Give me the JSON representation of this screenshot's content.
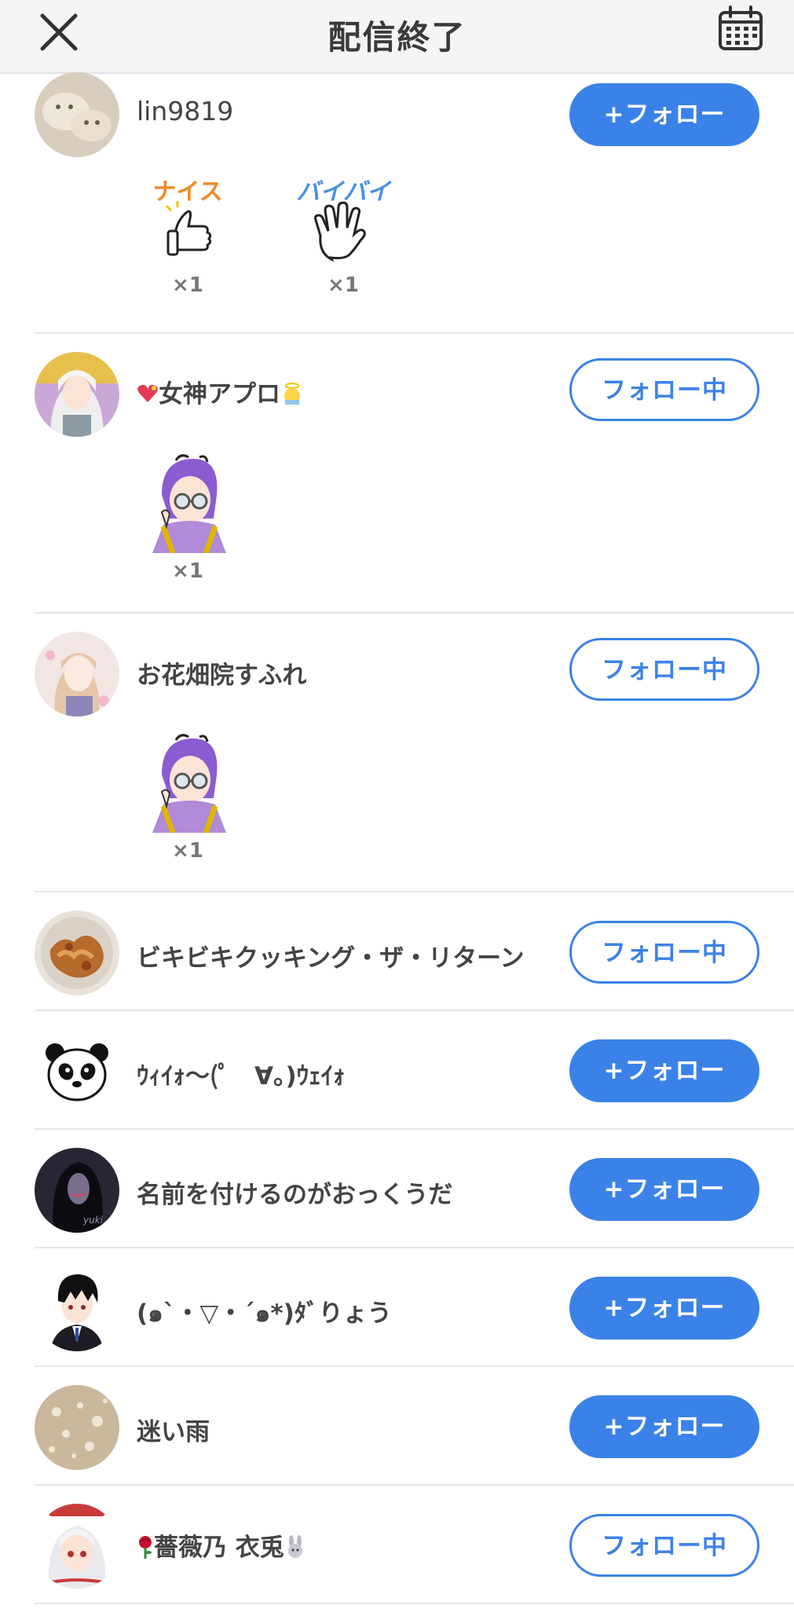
{
  "header": {
    "title": "配信終了"
  },
  "labels": {
    "follow": "+フォロー",
    "following": "フォロー中"
  },
  "gifts": {
    "nice_label": "ナイス",
    "byebye_label": "バイバイ",
    "count": "×1"
  },
  "users": [
    {
      "name": "lin9819",
      "following": false
    },
    {
      "name": "女神アプロ",
      "prefix_icon": "heart-icon",
      "suffix_icon": "angel-icon",
      "following": true
    },
    {
      "name": "お花畑院すふれ",
      "following": true
    },
    {
      "name": "ビキビキクッキング・ザ・リターン",
      "following": true
    },
    {
      "name": "ｳｨｲｫ〜(ﾟ　∀。)ｳｪｲｫ",
      "following": false
    },
    {
      "name": "名前を付けるのがおっくうだ",
      "following": false
    },
    {
      "name": "(๑ˋ・▽・ˊ๑*)ﾀﾞりょう",
      "following": false
    },
    {
      "name": "迷い雨",
      "following": false
    },
    {
      "name": "薔薇乃 衣兎",
      "prefix_icon": "rose-icon",
      "suffix_icon": "rabbit-icon",
      "following": true
    }
  ]
}
